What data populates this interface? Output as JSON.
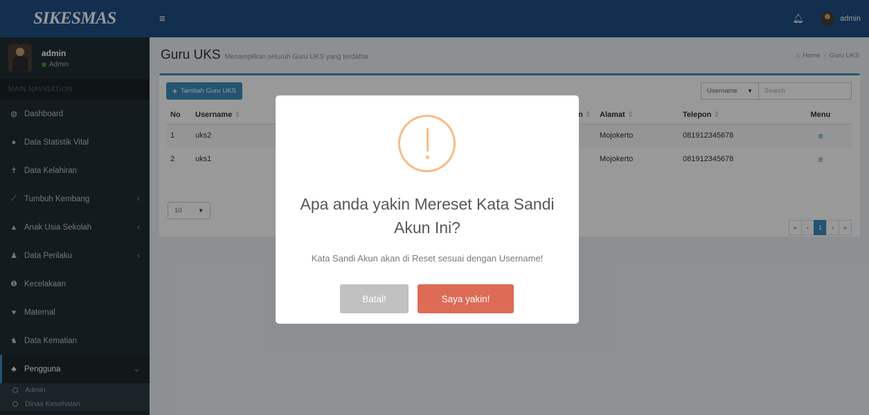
{
  "app": {
    "logo": "SIKESMAS"
  },
  "user": {
    "name": "admin",
    "status": "Admin"
  },
  "sidebar": {
    "header": "MAIN NAVIGATION",
    "items": [
      {
        "label": "Dashboard",
        "icon": "dashboard-icon"
      },
      {
        "label": "Data Statistik Vital",
        "icon": "user-icon"
      },
      {
        "label": "Data Kelahiran",
        "icon": "baby-icon"
      },
      {
        "label": "Tumbuh Kembang",
        "icon": "line-chart-icon"
      },
      {
        "label": "Anak Usia Sekolah",
        "icon": "graduation-cap-icon"
      },
      {
        "label": "Data Perilaku",
        "icon": "users-icon"
      },
      {
        "label": "Kecelakaan",
        "icon": "alert-circle-icon"
      },
      {
        "label": "Maternal",
        "icon": "heart-icon"
      },
      {
        "label": "Data Kematian",
        "icon": "user-times-icon"
      },
      {
        "label": "Pengguna",
        "icon": "group-icon"
      }
    ],
    "subitems": [
      {
        "label": "Admin"
      },
      {
        "label": "Dinas Kesehatan"
      }
    ]
  },
  "topbar": {
    "user_label": "admin"
  },
  "page": {
    "title": "Guru UKS",
    "subtitle": "Menampilkan seluruh Guru UKS yang terdaftar",
    "breadcrumb": {
      "home": "Home",
      "current": "Guru UKS"
    }
  },
  "toolbar": {
    "add_label": "Tambah Guru UKS",
    "filter_select": "Username",
    "search_placeholder": "Search"
  },
  "table": {
    "headers": {
      "no": "No",
      "username": "Username",
      "col_partial": "n",
      "alamat": "Alamat",
      "telepon": "Telepon",
      "menu": "Menu"
    },
    "rows": [
      {
        "no": "1",
        "username": "uks2",
        "alamat": "Mojokerto",
        "telepon": "081912345678"
      },
      {
        "no": "2",
        "username": "uks1",
        "alamat": "Mojokerto",
        "telepon": "081912345678"
      }
    ]
  },
  "pagination": {
    "per_page": "10",
    "first": "«",
    "prev": "‹",
    "current": "1",
    "next": "›",
    "last": "»"
  },
  "modal": {
    "title": "Apa anda yakin Mereset Kata Sandi Akun Ini?",
    "text": "Kata Sandi Akun akan di Reset sesuai dengan Username!",
    "cancel_label": "Batal!",
    "confirm_label": "Saya yakin!",
    "icon_color": "#f8bb86",
    "confirm_color": "#dd6b55",
    "cancel_color": "#c1c1c1"
  },
  "colors": {
    "brand": "#1e4f86",
    "sidebar": "#222d32",
    "accent": "#3c8dbc"
  }
}
